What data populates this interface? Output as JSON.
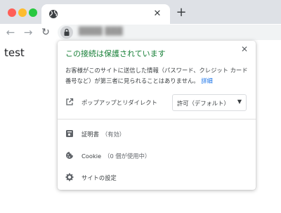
{
  "page": {
    "content_text": "test"
  },
  "tab": {
    "close_label": "✕"
  },
  "newtab": {
    "label": "+"
  },
  "toolbar": {
    "back": "←",
    "forward": "→",
    "reload": "↻",
    "url_blurred": "████ ███"
  },
  "popup": {
    "close_label": "✕",
    "title": "この接続は保護されています",
    "description": "お客様がこのサイトに送信した情報（パスワード、クレジット カード番号など）が第三者に見られることはありません。",
    "details_link": "詳細",
    "popups_row": {
      "label": "ポップアップとリダイレクト",
      "value": "許可（デフォルト）"
    },
    "certificate": {
      "label": "証明書",
      "sub": "（有効）"
    },
    "cookie": {
      "label": "Cookie",
      "sub": "（0 個が使用中）"
    },
    "site_settings": {
      "label": "サイトの設定"
    }
  }
}
